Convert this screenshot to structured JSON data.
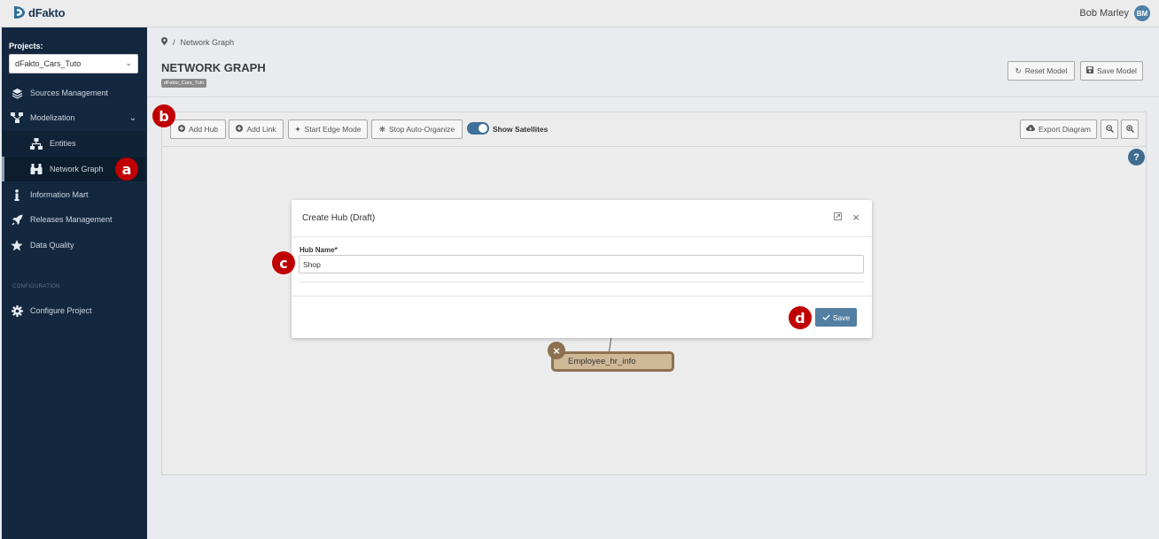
{
  "app": {
    "brand": "dFakto"
  },
  "user": {
    "name": "Bob Marley",
    "initials": "BM"
  },
  "sidebar": {
    "projects_label": "Projects:",
    "project_selected": "dFakto_Cars_Tuto",
    "items": [
      {
        "label": "Sources Management",
        "icon": "layers-icon"
      },
      {
        "label": "Modelization",
        "icon": "sitemap-icon"
      },
      {
        "label": "Entities",
        "icon": "hierarchy-icon"
      },
      {
        "label": "Network Graph",
        "icon": "binoculars-icon"
      },
      {
        "label": "Information Mart",
        "icon": "info-icon"
      },
      {
        "label": "Releases Management",
        "icon": "rocket-icon"
      },
      {
        "label": "Data Quality",
        "icon": "star-icon"
      }
    ],
    "section_label": "CONFIGURATION",
    "configure_label": "Configure Project"
  },
  "breadcrumb": {
    "current": "Network Graph",
    "separator": "/"
  },
  "page": {
    "title": "NETWORK GRAPH",
    "badge": "dFakto_Cars_Tuto"
  },
  "header_buttons": {
    "reset": "Reset Model",
    "save": "Save Model"
  },
  "toolbar": {
    "add_hub": "Add Hub",
    "add_link": "Add Link",
    "start_edge": "Start Edge Mode",
    "stop_auto": "Stop Auto-Organize",
    "show_satellites": "Show Satellites",
    "export": "Export Diagram"
  },
  "graph": {
    "node_label": "Employee_hr_info"
  },
  "modal": {
    "title": "Create Hub (Draft)",
    "field_label": "Hub Name*",
    "field_value": "Shop",
    "save": "Save"
  },
  "markers": {
    "a": "a",
    "b": "b",
    "c": "c",
    "d": "d"
  },
  "colors": {
    "sidebar": "#13283f",
    "accent": "#527fa3",
    "marker": "#c00000",
    "node": "#cfb896"
  }
}
